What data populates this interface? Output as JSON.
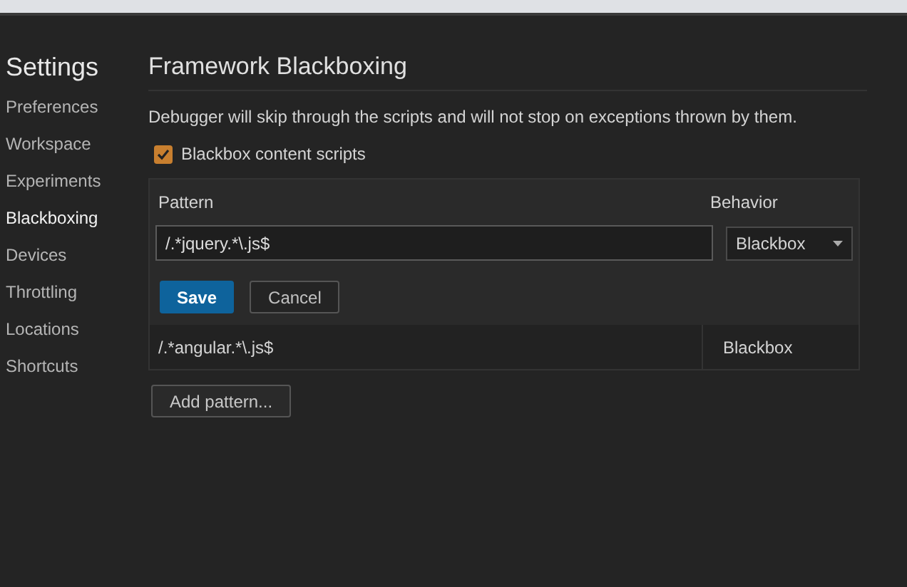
{
  "sidebar": {
    "title": "Settings",
    "items": [
      {
        "label": "Preferences",
        "selected": false
      },
      {
        "label": "Workspace",
        "selected": false
      },
      {
        "label": "Experiments",
        "selected": false
      },
      {
        "label": "Blackboxing",
        "selected": true
      },
      {
        "label": "Devices",
        "selected": false
      },
      {
        "label": "Throttling",
        "selected": false
      },
      {
        "label": "Locations",
        "selected": false
      },
      {
        "label": "Shortcuts",
        "selected": false
      }
    ]
  },
  "content": {
    "title": "Framework Blackboxing",
    "description": "Debugger will skip through the scripts and will not stop on exceptions thrown by them.",
    "checkbox": {
      "label": "Blackbox content scripts",
      "checked": true
    },
    "table": {
      "columns": [
        "Pattern",
        "Behavior"
      ],
      "editor": {
        "pattern": "/.*jquery.*\\.js$",
        "behavior": "Blackbox",
        "buttons": [
          "Save",
          "Cancel"
        ]
      },
      "rows": [
        {
          "pattern": "/.*angular.*\\.js$",
          "behavior": "Blackbox"
        }
      ]
    },
    "add_button": "Add pattern..."
  }
}
